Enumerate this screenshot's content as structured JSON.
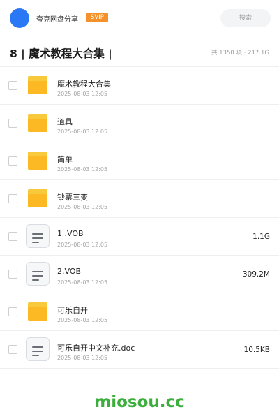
{
  "header": {
    "app_name": "夸克网盘分享",
    "badge": "SVIP",
    "search_label": "搜索",
    "avatar_color": "#2b78f6",
    "accent_color": "#f5912b"
  },
  "folder": {
    "title": "8 | 魔术教程大合集 |",
    "meta": "共 1350 项 · 217.1G"
  },
  "files": [
    {
      "name": "魔术教程大合集",
      "date": "2025-08-03 12:05",
      "size": "",
      "type": "folder"
    },
    {
      "name": "道具",
      "date": "2025-08-03 12:05",
      "size": "",
      "type": "folder"
    },
    {
      "name": "简单",
      "date": "2025-08-03 12:05",
      "size": "",
      "type": "folder"
    },
    {
      "name": "钞票三变",
      "date": "2025-08-03 12:05",
      "size": "",
      "type": "folder"
    },
    {
      "name": "1 .VOB",
      "date": "2025-08-03 12:05",
      "size": "1.1G",
      "type": "file"
    },
    {
      "name": "2.VOB",
      "date": "2025-08-03 12:05",
      "size": "309.2M",
      "type": "file"
    },
    {
      "name": "可乐自开",
      "date": "2025-08-03 12:05",
      "size": "",
      "type": "folder"
    },
    {
      "name": "可乐自开中文补充.doc",
      "date": "2025-08-03 12:05",
      "size": "10.5KB",
      "type": "file"
    }
  ],
  "footer": {
    "watermark": "miosou.cc",
    "watermark_color": "#3cae3c"
  }
}
